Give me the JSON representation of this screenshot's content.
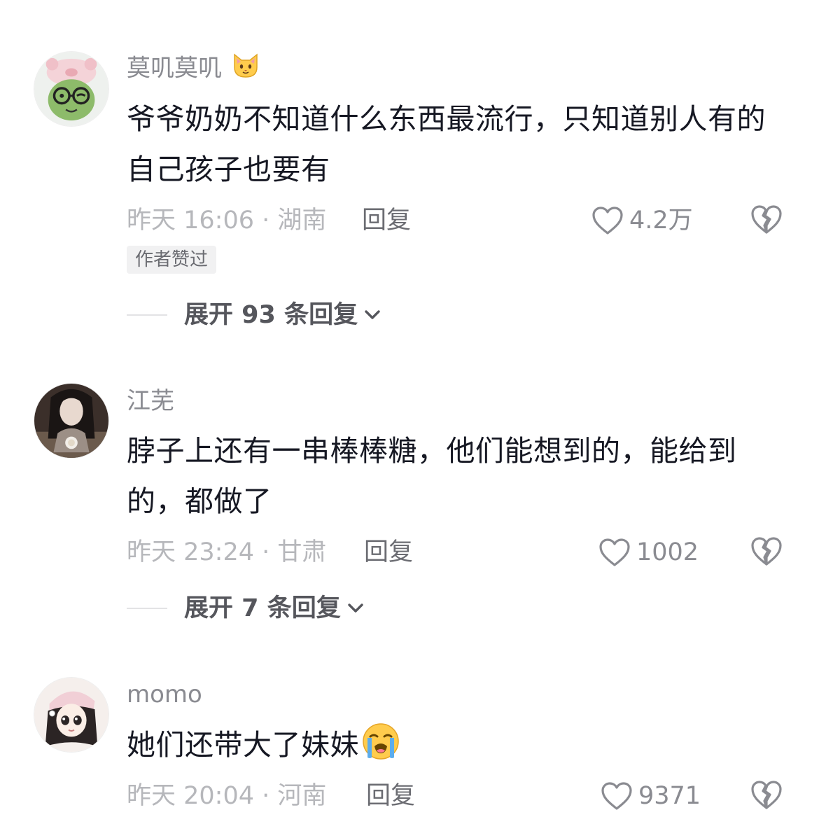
{
  "comments": [
    {
      "username": "莫叽莫叽",
      "username_emoji": "cat-face-emoji",
      "text": "爷爷奶奶不知道什么东西最流行，只知道别人有的自己孩子也要有",
      "text_emoji": "",
      "meta": "昨天 16:06 · 湖南",
      "reply_label": "回复",
      "likes": "4.2万",
      "badge": "作者赞过",
      "expand_label": "展开 93 条回复"
    },
    {
      "username": "江芜",
      "username_emoji": "",
      "text": "脖子上还有一串棒棒糖，他们能想到的，能给到的，都做了",
      "text_emoji": "",
      "meta": "昨天 23:24 · 甘肃",
      "reply_label": "回复",
      "likes": "1002",
      "badge": "",
      "expand_label": "展开 7 条回复"
    },
    {
      "username": "momo",
      "username_emoji": "",
      "text": "她们还带大了妹妹",
      "text_emoji": "loudly-crying-face-emoji",
      "meta": "昨天 20:04 · 河南",
      "reply_label": "回复",
      "likes": "9371",
      "badge": "",
      "expand_label": ""
    }
  ],
  "icons": {
    "like": "heart-outline-icon",
    "dislike": "broken-heart-icon",
    "expand": "chevron-down-icon"
  },
  "colors": {
    "background": "#ffffff",
    "text_primary": "#161823",
    "text_secondary": "#8a8b91",
    "meta": "#b6b7bb",
    "badge_bg": "#f1f1f2"
  }
}
